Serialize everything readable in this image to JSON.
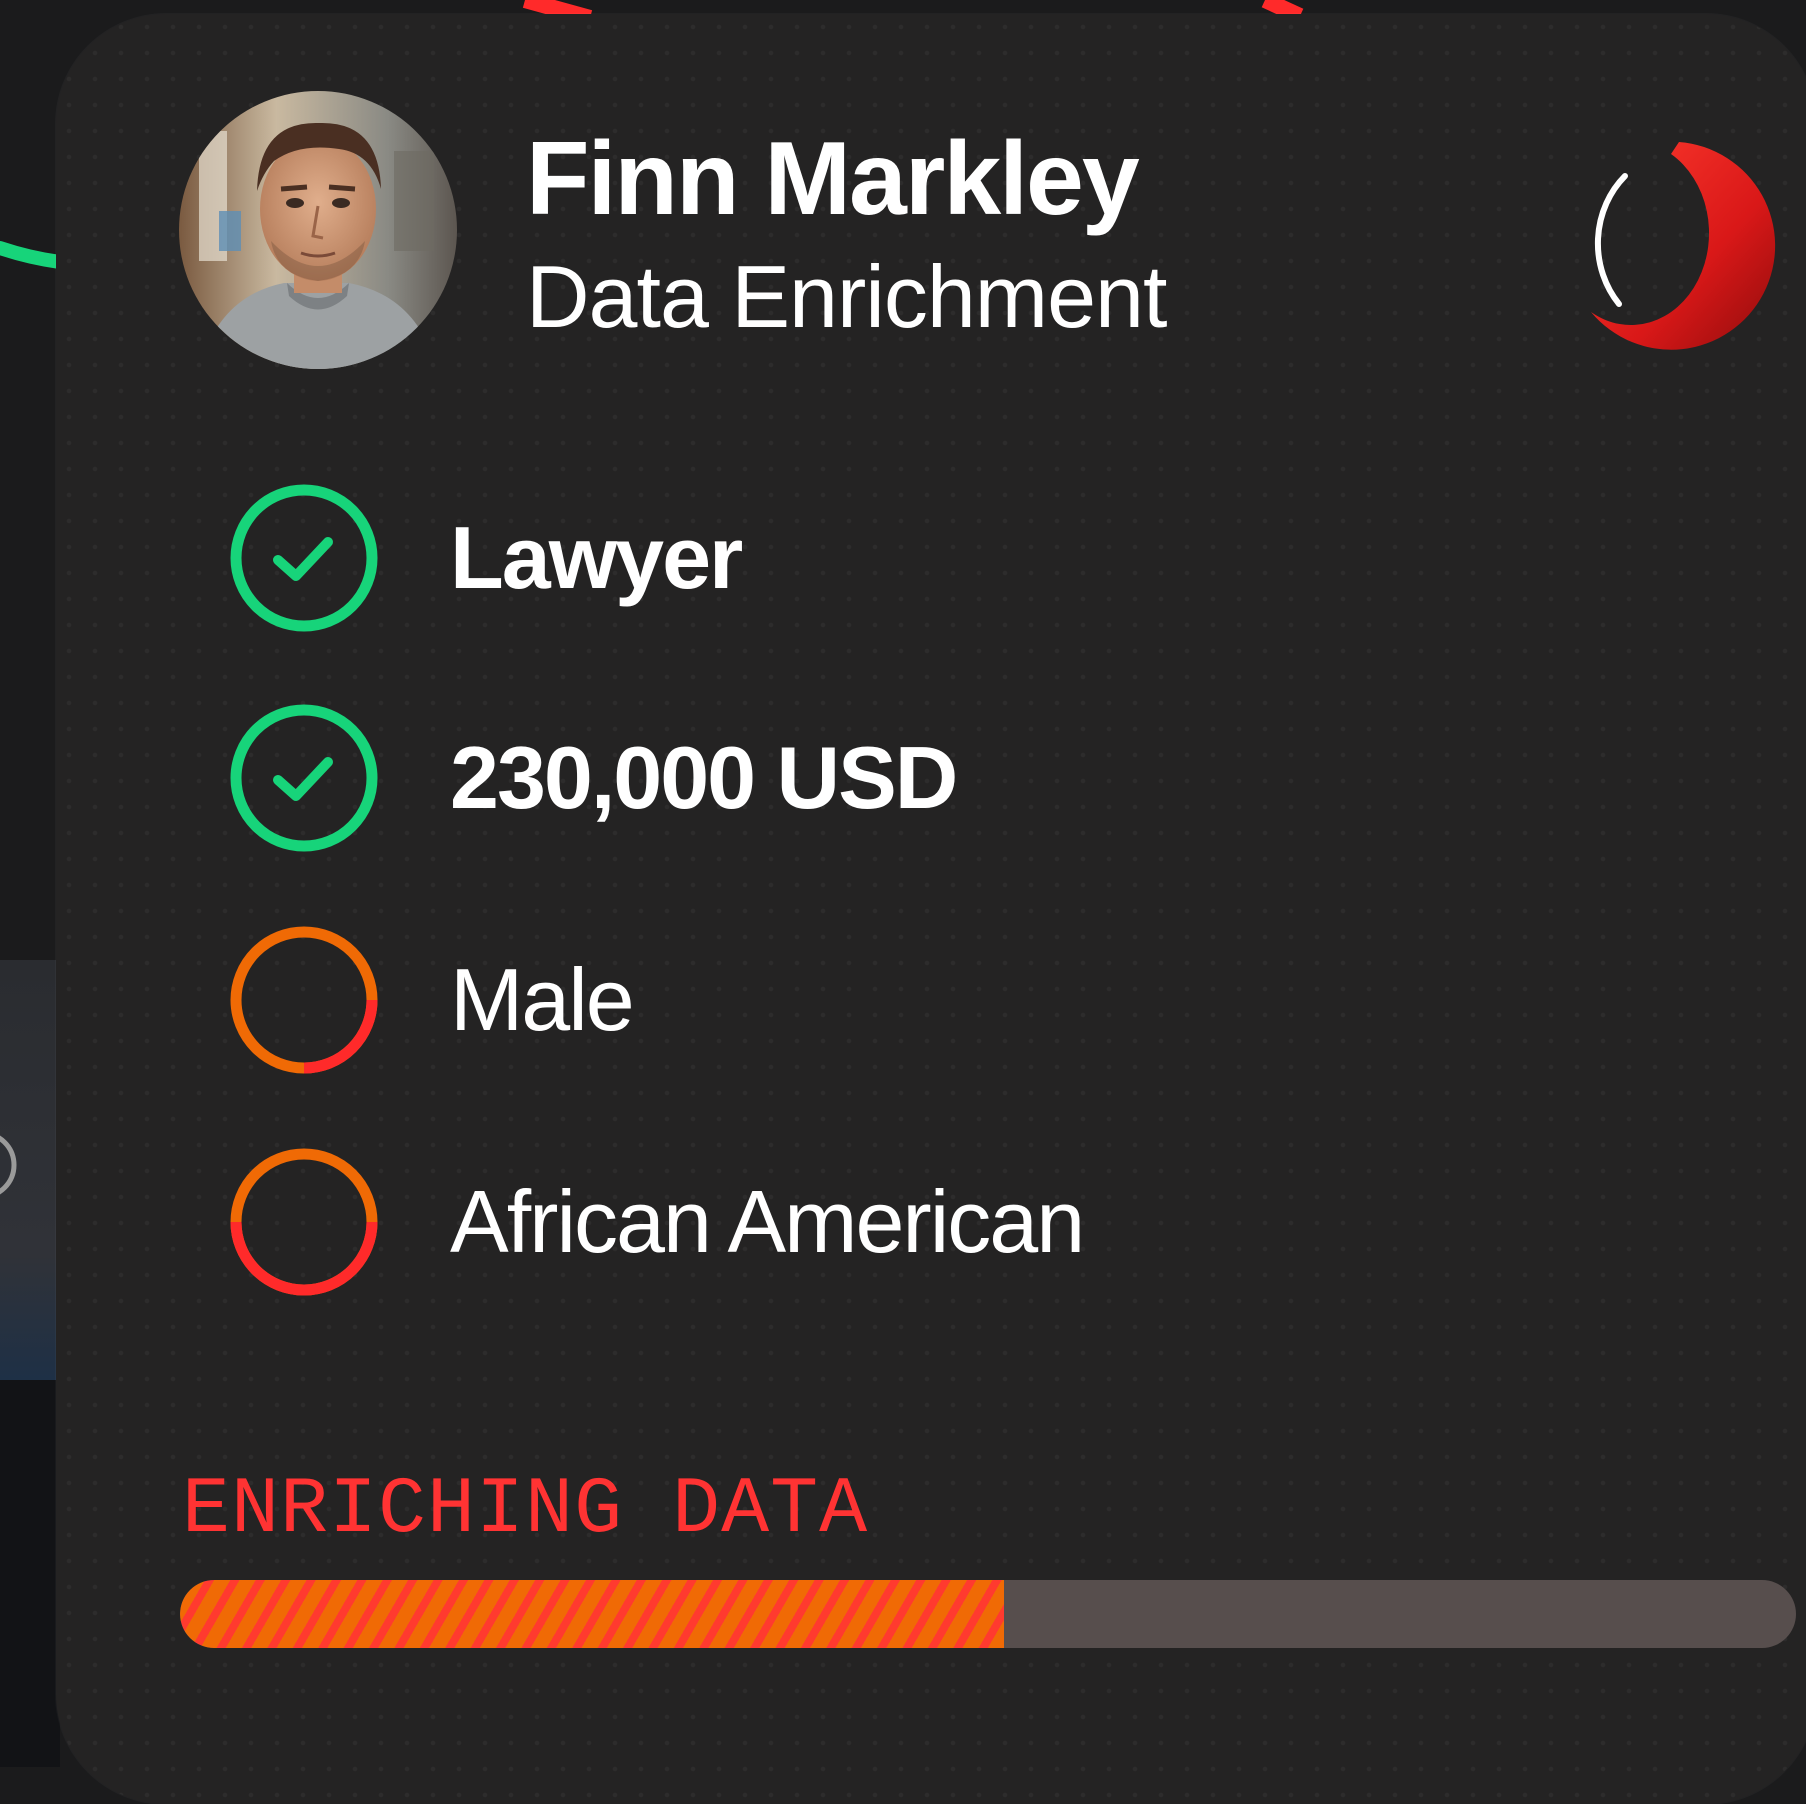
{
  "profile": {
    "name": "Finn Markley",
    "subtitle": "Data Enrichment",
    "avatar_icon": "person-photo"
  },
  "brand": {
    "logo_icon": "red-crescent-ring-logo"
  },
  "attributes": [
    {
      "label": "Lawyer",
      "status": "complete",
      "icon": "check-circle-icon"
    },
    {
      "label": "230,000 USD",
      "status": "complete",
      "icon": "check-circle-icon"
    },
    {
      "label": "Male",
      "status": "in-progress",
      "icon": "progress-ring-icon"
    },
    {
      "label": "African American",
      "status": "in-progress",
      "icon": "progress-ring-icon"
    }
  ],
  "progress": {
    "label": "ENRICHING DATA",
    "percent": 51
  },
  "colors": {
    "complete": "#17d47a",
    "pending_orange": "#f06a05",
    "pending_red": "#ff2a2a",
    "progress_label": "#ff3333",
    "track": "#574e4d",
    "card": "#242323"
  }
}
